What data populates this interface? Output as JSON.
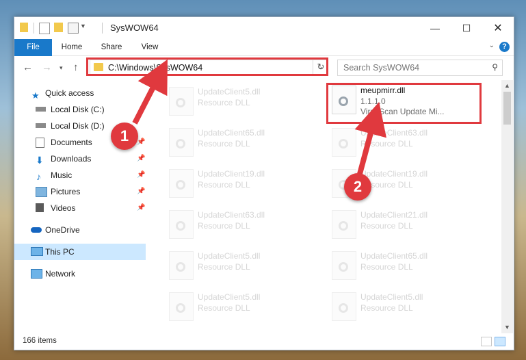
{
  "window": {
    "title": "SysWOW64"
  },
  "ribbon": {
    "tabs": [
      "File",
      "Home",
      "Share",
      "View"
    ],
    "help_label": "?"
  },
  "address": {
    "path": "C:\\Windows\\SysWOW64"
  },
  "search": {
    "placeholder": "Search SysWOW64"
  },
  "nav": {
    "items": [
      {
        "label": "Quick access",
        "icon": "star-icon",
        "pinned": false
      },
      {
        "label": "Local Disk (C:)",
        "icon": "drive-icon",
        "pinned": false
      },
      {
        "label": "Local Disk (D:)",
        "icon": "drive-icon",
        "pinned": false
      },
      {
        "label": "Documents",
        "icon": "documents-icon",
        "pinned": true
      },
      {
        "label": "Downloads",
        "icon": "download-icon",
        "pinned": true
      },
      {
        "label": "Music",
        "icon": "music-icon",
        "pinned": true
      },
      {
        "label": "Pictures",
        "icon": "pictures-icon",
        "pinned": true
      },
      {
        "label": "Videos",
        "icon": "videos-icon",
        "pinned": true
      },
      {
        "label": "OneDrive",
        "icon": "cloud-icon",
        "pinned": false
      },
      {
        "label": "This PC",
        "icon": "computer-icon",
        "pinned": false
      },
      {
        "label": "Network",
        "icon": "network-icon",
        "pinned": false
      }
    ]
  },
  "files": {
    "left": [
      {
        "name": "UpdateClient5.dll",
        "type": "Resource DLL"
      },
      {
        "name": "UpdateClient65.dll",
        "type": "Resource DLL"
      },
      {
        "name": "UpdateClient19.dll",
        "type": "Resource DLL"
      },
      {
        "name": "UpdateClient63.dll",
        "type": "Resource DLL"
      },
      {
        "name": "UpdateClient5.dll",
        "type": "Resource DLL"
      },
      {
        "name": "UpdateClient5.dll",
        "type": "Resource DLL"
      }
    ],
    "right": [
      {
        "name": "UpdateClient63.dll",
        "type": "Resource DLL"
      },
      {
        "name": "UpdateClient19.dll",
        "type": "Resource DLL"
      },
      {
        "name": "UpdateClient21.dll",
        "type": "Resource DLL"
      },
      {
        "name": "UpdateClient65.dll",
        "type": "Resource DLL"
      },
      {
        "name": "UpdateClient5.dll",
        "type": "Resource DLL"
      }
    ],
    "highlighted": {
      "name": "meupmirr.dll",
      "version": "1.1.1.0",
      "description": "VirusScan Update Mi..."
    }
  },
  "status": {
    "item_count": "166 items"
  },
  "annotations": {
    "step1": "1",
    "step2": "2",
    "color": "#e0393e"
  }
}
